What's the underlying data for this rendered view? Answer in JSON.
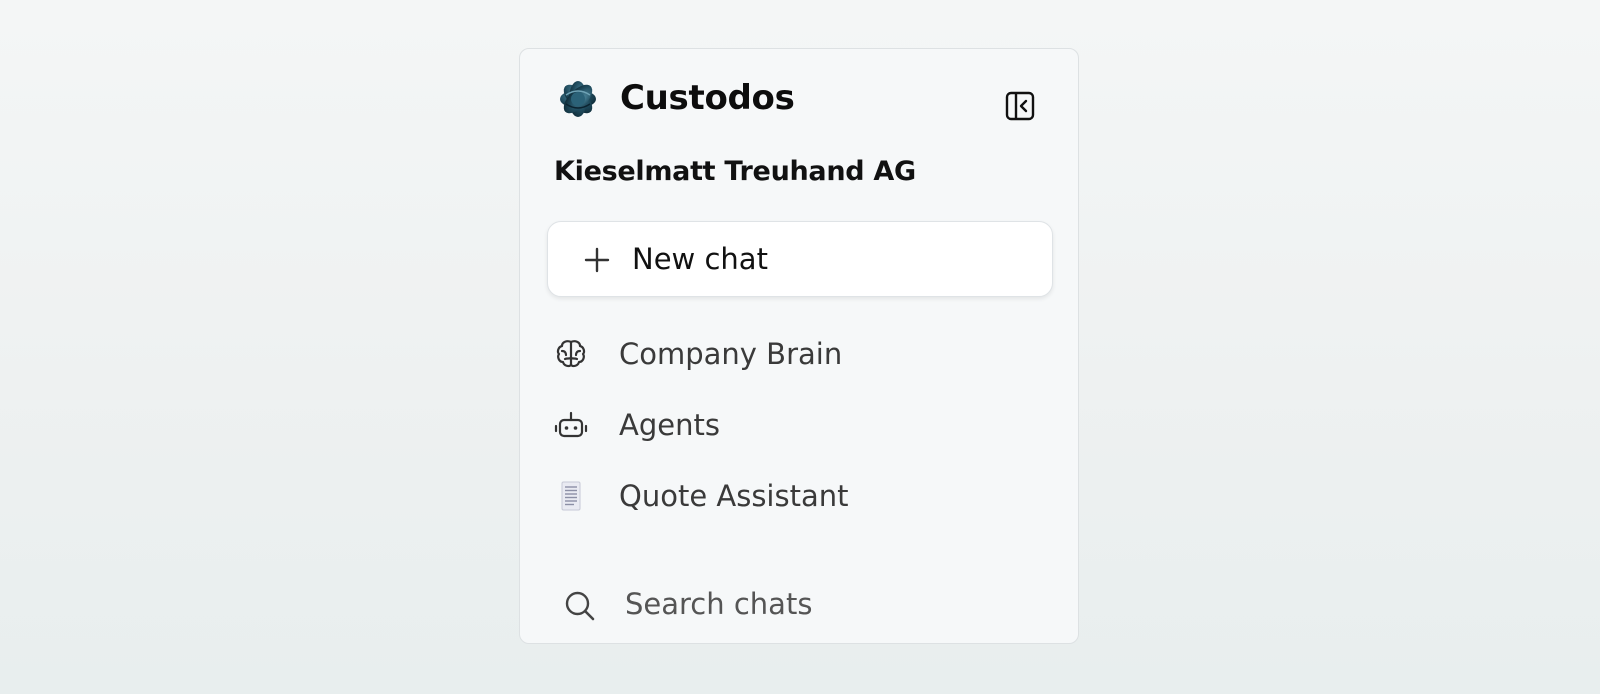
{
  "header": {
    "app_name": "Custodos",
    "logo_icon": "custodos-logo-icon",
    "collapse_icon": "sidebar-collapse-icon"
  },
  "organization": {
    "name": "Kieselmatt Treuhand AG"
  },
  "new_chat": {
    "label": "New chat",
    "icon": "plus-icon"
  },
  "nav": {
    "items": [
      {
        "label": "Company Brain",
        "icon": "brain-icon"
      },
      {
        "label": "Agents",
        "icon": "robot-icon"
      },
      {
        "label": "Quote Assistant",
        "icon": "document-icon"
      }
    ]
  },
  "search": {
    "label": "Search chats",
    "icon": "search-icon"
  },
  "colors": {
    "background": "#eef1f1",
    "sidebar": "#f6f8f9",
    "logo": "#1f4a5c"
  }
}
